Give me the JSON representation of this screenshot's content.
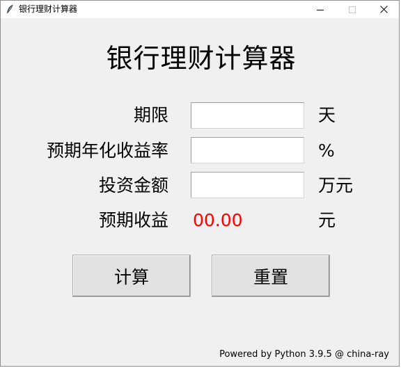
{
  "window": {
    "title": "银行理财计算器",
    "controls": {
      "minimize_icon": "minimize-icon",
      "maximize_icon": "maximize-icon",
      "close_icon": "close-icon"
    }
  },
  "main": {
    "title": "银行理财计算器",
    "rows": [
      {
        "label": "期限",
        "value": "",
        "unit": "天"
      },
      {
        "label": "预期年化收益率",
        "value": "",
        "unit": "%"
      },
      {
        "label": "投资金额",
        "value": "",
        "unit": "万元"
      }
    ],
    "result": {
      "label": "预期收益",
      "value": "00.00",
      "unit": "元",
      "color": "#ff0000"
    },
    "buttons": {
      "calculate": "计算",
      "reset": "重置"
    },
    "footer": "Powered by Python 3.9.5 @ china-ray"
  }
}
